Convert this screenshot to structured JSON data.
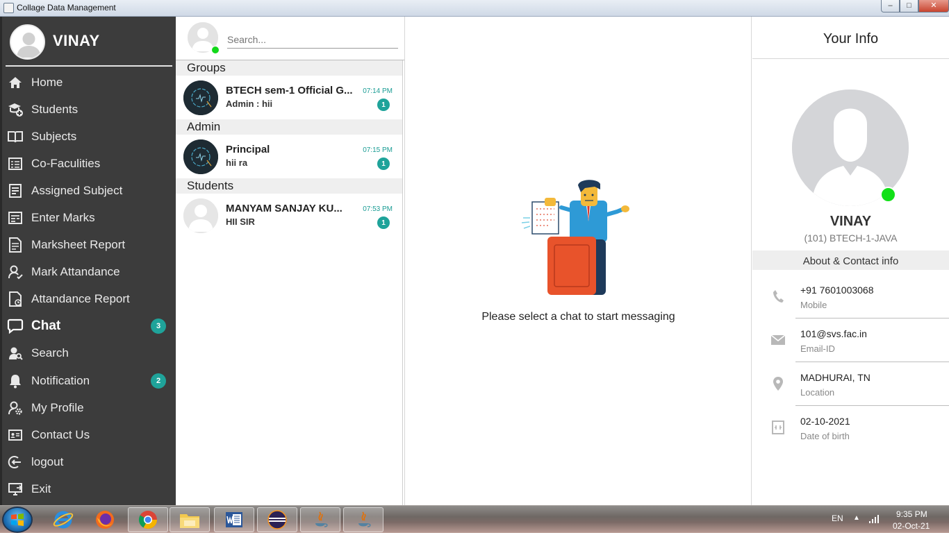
{
  "window": {
    "title": "Collage Data Management",
    "min_label": "–",
    "max_label": "□",
    "close_label": "✕"
  },
  "profile": {
    "name": "VINAY",
    "icon": "user-avatar"
  },
  "menu": [
    {
      "label": "Home",
      "icon": "home-icon"
    },
    {
      "label": "Students",
      "icon": "student-icon"
    },
    {
      "label": "Subjects",
      "icon": "book-icon"
    },
    {
      "label": "Co-Faculities",
      "icon": "faculty-list-icon"
    },
    {
      "label": "Assigned Subject",
      "icon": "assign-icon"
    },
    {
      "label": "Enter Marks",
      "icon": "marks-icon"
    },
    {
      "label": "Marksheet Report",
      "icon": "report-icon"
    },
    {
      "label": "Mark Attandance",
      "icon": "attendance-user-icon"
    },
    {
      "label": "Attandance Report",
      "icon": "attendance-report-icon"
    },
    {
      "label": "Chat",
      "icon": "chat-icon",
      "badge": "3",
      "active": true
    },
    {
      "label": "Search",
      "icon": "search-user-icon"
    },
    {
      "label": "Notification",
      "icon": "bell-icon",
      "badge": "2"
    },
    {
      "label": "My Profile",
      "icon": "profile-gear-icon"
    },
    {
      "label": "Contact Us",
      "icon": "contact-card-icon"
    },
    {
      "label": "logout",
      "icon": "logout-icon"
    },
    {
      "label": "Exit",
      "icon": "exit-icon"
    }
  ],
  "chat_list": {
    "search_placeholder": "Search...",
    "sections": [
      {
        "title": "Groups",
        "items": [
          {
            "name": "BTECH sem-1 Official G...",
            "message": "Admin : hii",
            "time": "07:14 PM",
            "unread": "1",
            "avatar": "group-logo"
          }
        ]
      },
      {
        "title": "Admin",
        "items": [
          {
            "name": "Principal",
            "message": "hii ra",
            "time": "07:15 PM",
            "unread": "1",
            "avatar": "group-logo"
          }
        ]
      },
      {
        "title": "Students",
        "items": [
          {
            "name": "MANYAM SANJAY KU...",
            "message": "HII SIR",
            "time": "07:53 PM",
            "unread": "1",
            "avatar": "person"
          }
        ]
      }
    ]
  },
  "center": {
    "message": "Please select a chat to start messaging"
  },
  "info": {
    "title": "Your Info",
    "name": "VINAY",
    "subtitle": "(101) BTECH-1-JAVA",
    "section_title": "About & Contact info",
    "contacts": [
      {
        "value": "+91 7601003068",
        "label": "Mobile",
        "icon": "phone-icon"
      },
      {
        "value": "101@svs.fac.in",
        "label": "Email-ID",
        "icon": "mail-icon"
      },
      {
        "value": "MADHURAI, TN",
        "label": "Location",
        "icon": "location-icon"
      },
      {
        "value": "02-10-2021",
        "label": "Date of birth",
        "icon": "calendar-icon"
      }
    ]
  },
  "taskbar": {
    "language": "EN",
    "time": "9:35 PM",
    "date": "02-Oct-21",
    "apps": [
      "internet-explorer",
      "firefox",
      "chrome",
      "file-explorer",
      "word",
      "eclipse",
      "java",
      "java"
    ]
  },
  "colors": {
    "sidebar": "#3c3c3c",
    "accent": "#1fa39a",
    "online": "#12d81a"
  }
}
